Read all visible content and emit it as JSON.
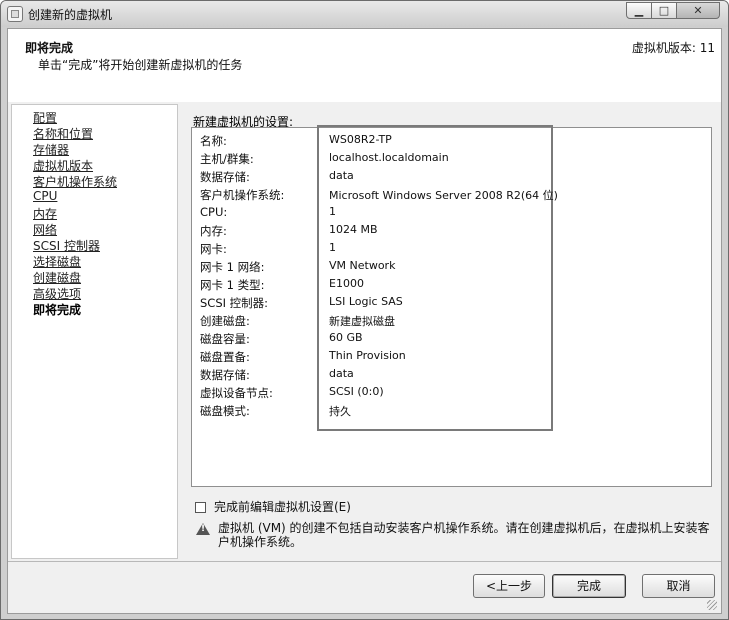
{
  "window": {
    "title": "创建新的虚拟机",
    "min_glyph": "▁",
    "max_glyph": "□",
    "close_glyph": "✕"
  },
  "header": {
    "title": "即将完成",
    "subtitle": "单击“完成”将开始创建新虚拟机的任务",
    "version": "虚拟机版本: 11"
  },
  "steps": [
    {
      "label": "配置",
      "current": false
    },
    {
      "label": "名称和位置",
      "current": false
    },
    {
      "label": "存储器",
      "current": false
    },
    {
      "label": "虚拟机版本",
      "current": false
    },
    {
      "label": "客户机操作系统",
      "current": false
    },
    {
      "label": "CPU",
      "current": false
    },
    {
      "label": "内存",
      "current": false
    },
    {
      "label": "网络",
      "current": false
    },
    {
      "label": "SCSI 控制器",
      "current": false
    },
    {
      "label": "选择磁盘",
      "current": false
    },
    {
      "label": "创建磁盘",
      "current": false
    },
    {
      "label": "高级选项",
      "current": false
    },
    {
      "label": "即将完成",
      "current": true
    }
  ],
  "settings": {
    "label": "新建虚拟机的设置:",
    "rows": [
      {
        "key": "名称:",
        "value": "WS08R2-TP"
      },
      {
        "key": "主机/群集:",
        "value": "localhost.localdomain"
      },
      {
        "key": "数据存储:",
        "value": "data"
      },
      {
        "key": "客户机操作系统:",
        "value": "Microsoft Windows Server 2008 R2(64 位)"
      },
      {
        "key": "CPU:",
        "value": "1"
      },
      {
        "key": "内存:",
        "value": "1024 MB"
      },
      {
        "key": "网卡:",
        "value": "1"
      },
      {
        "key": "网卡 1 网络:",
        "value": "VM Network"
      },
      {
        "key": "网卡 1 类型:",
        "value": "E1000"
      },
      {
        "key": "SCSI 控制器:",
        "value": "LSI Logic SAS"
      },
      {
        "key": "创建磁盘:",
        "value": "新建虚拟磁盘"
      },
      {
        "key": "磁盘容量:",
        "value": "60 GB"
      },
      {
        "key": "磁盘置备:",
        "value": "Thin Provision"
      },
      {
        "key": "数据存储:",
        "value": "data"
      },
      {
        "key": "虚拟设备节点:",
        "value": "SCSI (0:0)"
      },
      {
        "key": "磁盘模式:",
        "value": "持久"
      }
    ]
  },
  "edit_checkbox": {
    "label": "完成前编辑虚拟机设置(E)",
    "checked": false
  },
  "warning": {
    "icon": "warning-icon",
    "text": "虚拟机 (VM) 的创建不包括自动安装客户机操作系统。请在创建虚拟机后，在虚拟机上安装客户机操作系统。"
  },
  "buttons": {
    "back": "<上一步",
    "finish": "完成",
    "cancel": "取消"
  }
}
